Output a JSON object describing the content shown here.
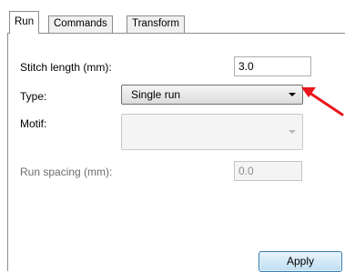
{
  "tabs": [
    {
      "label": "Run",
      "active": true
    },
    {
      "label": "Commands",
      "active": false
    },
    {
      "label": "Transform",
      "active": false
    }
  ],
  "form": {
    "stitch_length": {
      "label": "Stitch length (mm):",
      "value": "3.0"
    },
    "type": {
      "label": "Type:",
      "selected": "Single run"
    },
    "motif": {
      "label": "Motif:",
      "selected": "",
      "disabled": true
    },
    "run_spacing": {
      "label": "Run spacing (mm):",
      "value": "0.0",
      "disabled": true
    }
  },
  "buttons": {
    "apply": "Apply"
  },
  "colors": {
    "annotation_arrow": "#e8151b",
    "button_border": "#3c7fb1"
  },
  "icons": [
    "chevron-down-icon",
    "red-annotation-arrow"
  ]
}
